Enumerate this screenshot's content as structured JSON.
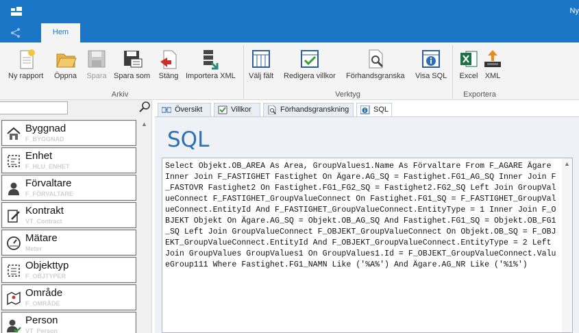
{
  "title_bar": {
    "text": "Ny"
  },
  "ribbon_tabs": [
    {
      "label": "Hem",
      "active": true
    }
  ],
  "ribbon": {
    "groups": [
      {
        "label": "Arkiv",
        "buttons": [
          {
            "label": "Ny rapport",
            "icon": "new-report-icon",
            "enabled": true
          },
          {
            "label": "Öppna",
            "icon": "open-folder-icon",
            "enabled": true
          },
          {
            "label": "Spara",
            "icon": "save-icon",
            "enabled": false
          },
          {
            "label": "Spara som",
            "icon": "save-as-icon",
            "enabled": true
          },
          {
            "label": "Stäng",
            "icon": "close-document-icon",
            "enabled": true
          },
          {
            "label": "Importera XML",
            "icon": "import-xml-icon",
            "enabled": true
          }
        ]
      },
      {
        "label": "Verktyg",
        "buttons": [
          {
            "label": "Välj fält",
            "icon": "select-fields-icon",
            "enabled": true
          },
          {
            "label": "Redigera villkor",
            "icon": "edit-conditions-icon",
            "enabled": true
          },
          {
            "label": "Förhandsgranska",
            "icon": "preview-icon",
            "enabled": true
          },
          {
            "label": "Visa SQL",
            "icon": "show-sql-icon",
            "enabled": true
          }
        ]
      },
      {
        "label": "Exportera",
        "buttons": [
          {
            "label": "Excel",
            "icon": "excel-icon",
            "enabled": true
          },
          {
            "label": "XML",
            "icon": "xml-export-icon",
            "enabled": true
          }
        ]
      }
    ]
  },
  "left_panel": {
    "search": {
      "value": "",
      "placeholder": ""
    },
    "items": [
      {
        "name": "Byggnad",
        "sub": "F_BYGGNAD",
        "icon": "building-icon"
      },
      {
        "name": "Enhet",
        "sub": "F_HLU_ENHET",
        "icon": "unit-icon"
      },
      {
        "name": "Förvaltare",
        "sub": "F_FÖRVALTARE",
        "icon": "person-icon"
      },
      {
        "name": "Kontrakt",
        "sub": "VT_Contract",
        "icon": "contract-icon"
      },
      {
        "name": "Mätare",
        "sub": "Meter",
        "icon": "meter-icon"
      },
      {
        "name": "Objekttyp",
        "sub": "F_OBJTYPER",
        "icon": "object-type-icon"
      },
      {
        "name": "Område",
        "sub": "F_OMRÅDE",
        "icon": "area-map-icon"
      },
      {
        "name": "Person",
        "sub": "VT_Person",
        "icon": "person-check-icon"
      }
    ]
  },
  "view_tabs": [
    {
      "label": "Översikt",
      "icon": "overview-icon",
      "active": false
    },
    {
      "label": "Villkor",
      "icon": "conditions-check-icon",
      "active": false
    },
    {
      "label": "Förhandsgranskning",
      "icon": "preview-doc-icon",
      "active": false
    },
    {
      "label": "SQL",
      "icon": "sql-info-icon",
      "active": true
    }
  ],
  "sql_view": {
    "heading": "SQL",
    "query": "Select Objekt.OB_AREA As Area, GroupValues1.Name As Förvaltare From F_AGARE Ägare Inner Join F_FASTIGHET Fastighet On Ägare.AG_SQ = Fastighet.FG1_AG_SQ Inner Join F_FASTOVR Fastighet2 On Fastighet.FG1_FG2_SQ = Fastighet2.FG2_SQ Left Join GroupValueConnect F_FASTIGHET_GroupValueConnect On Fastighet.FG1_SQ = F_FASTIGHET_GroupValueConnect.EntityId And F_FASTIGHET_GroupValueConnect.EntityType = 1 Inner Join F_OBJEKT Objekt On Ägare.AG_SQ = Objekt.OB_AG_SQ And Fastighet.FG1_SQ = Objekt.OB_FG1_SQ Left Join GroupValueConnect F_OBJEKT_GroupValueConnect On Objekt.OB_SQ = F_OBJEKT_GroupValueConnect.EntityId And F_OBJEKT_GroupValueConnect.EntityType = 2 Left Join GroupValues GroupValues1 On GroupValues1.Id = F_OBJEKT_GroupValueConnect.ValueGroup111 Where Fastighet.FG1_NAMN Like ('%A%') And Ägare.AG_NR Like ('%1%')"
  },
  "colors": {
    "accent": "#1c76c8",
    "sql_heading": "#2d6fb3"
  }
}
